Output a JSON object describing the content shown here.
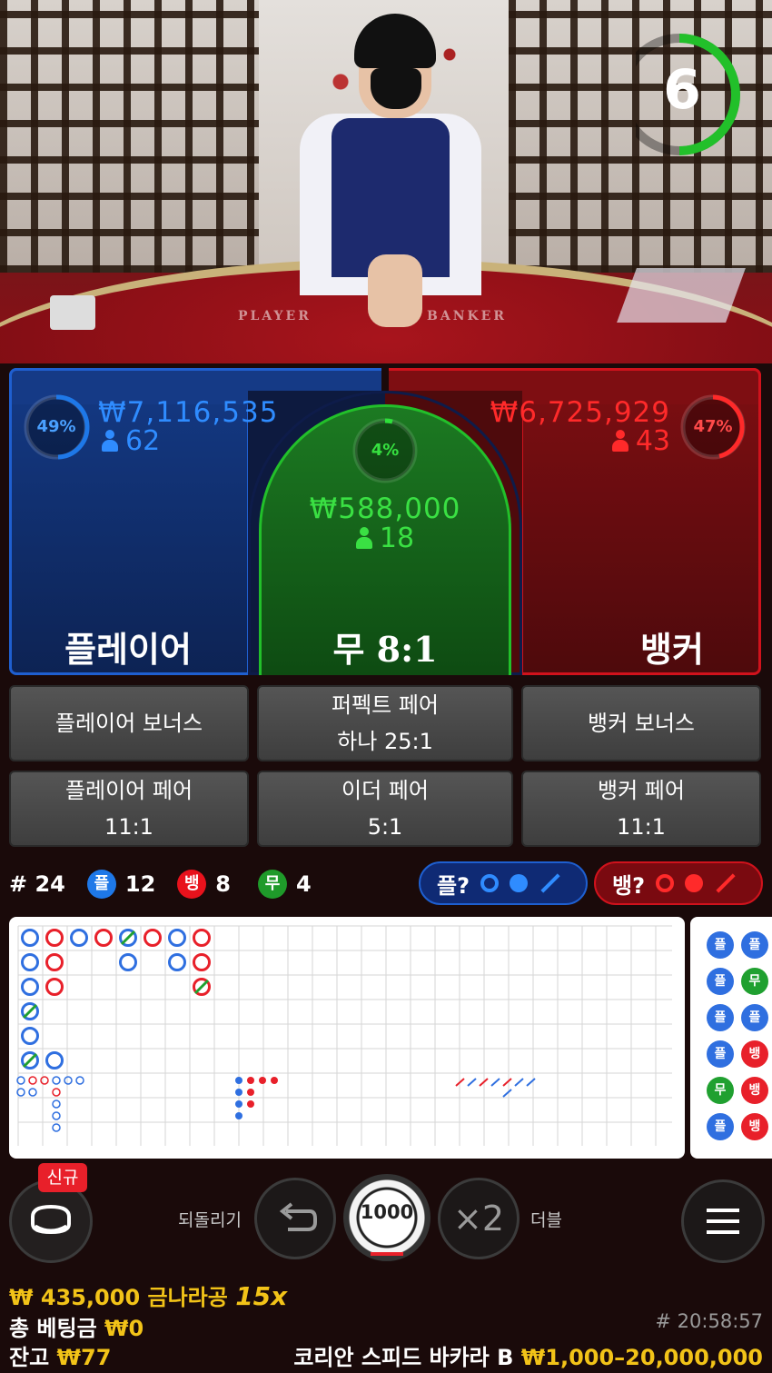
{
  "video": {
    "felt_player": "PLAYER",
    "felt_banker": "BANKER",
    "timer": "6"
  },
  "player": {
    "percent": "49%",
    "amount": "₩7,116,535",
    "count": "62",
    "label": "플레이어"
  },
  "banker": {
    "percent": "47%",
    "amount": "₩6,725,929",
    "count": "43",
    "label": "뱅커"
  },
  "tie": {
    "percent": "4%",
    "amount": "₩588,000",
    "count": "18",
    "label": "무",
    "odds": "8:1"
  },
  "side_bets": [
    {
      "line1": "플레이어 보너스",
      "line2": ""
    },
    {
      "line1": "퍼펙트 페어",
      "line2": "하나 25:1"
    },
    {
      "line1": "뱅커 보너스",
      "line2": ""
    },
    {
      "line1": "플레이어 페어",
      "line2": "11:1"
    },
    {
      "line1": "이더 페어",
      "line2": "5:1"
    },
    {
      "line1": "뱅커 페어",
      "line2": "11:1"
    }
  ],
  "stats": {
    "round_label": "# 24",
    "player_badge": "플",
    "player_count": "12",
    "banker_badge": "뱅",
    "banker_count": "8",
    "tie_badge": "무",
    "tie_count": "4"
  },
  "ask": {
    "player": "플?",
    "banker": "뱅?"
  },
  "bead_preview": [
    "플",
    "플",
    "플",
    "무",
    "플",
    "플",
    "플",
    "뱅",
    "무",
    "뱅",
    "플",
    "뱅"
  ],
  "controls": {
    "new_badge": "신규",
    "undo_label": "되돌리기",
    "chip_value": "1000",
    "double_symbol": "×2",
    "double_label": "더블"
  },
  "footer": {
    "jackpot_amount": "₩ 435,000",
    "jackpot_label": "금나라공",
    "jackpot_mult": "15x",
    "total_bet_label": "총 베팅금",
    "total_bet_value": "₩0",
    "balance_label": "잔고",
    "balance_value": "₩77",
    "round_time": "# 20:58:57",
    "table_name": "코리안 스피드 바카라 B",
    "limits": "₩1,000–20,000,000"
  },
  "colors": {
    "player": "#1e78e8",
    "banker": "#e8121c",
    "tie": "#20b030",
    "gold": "#f2c318"
  }
}
